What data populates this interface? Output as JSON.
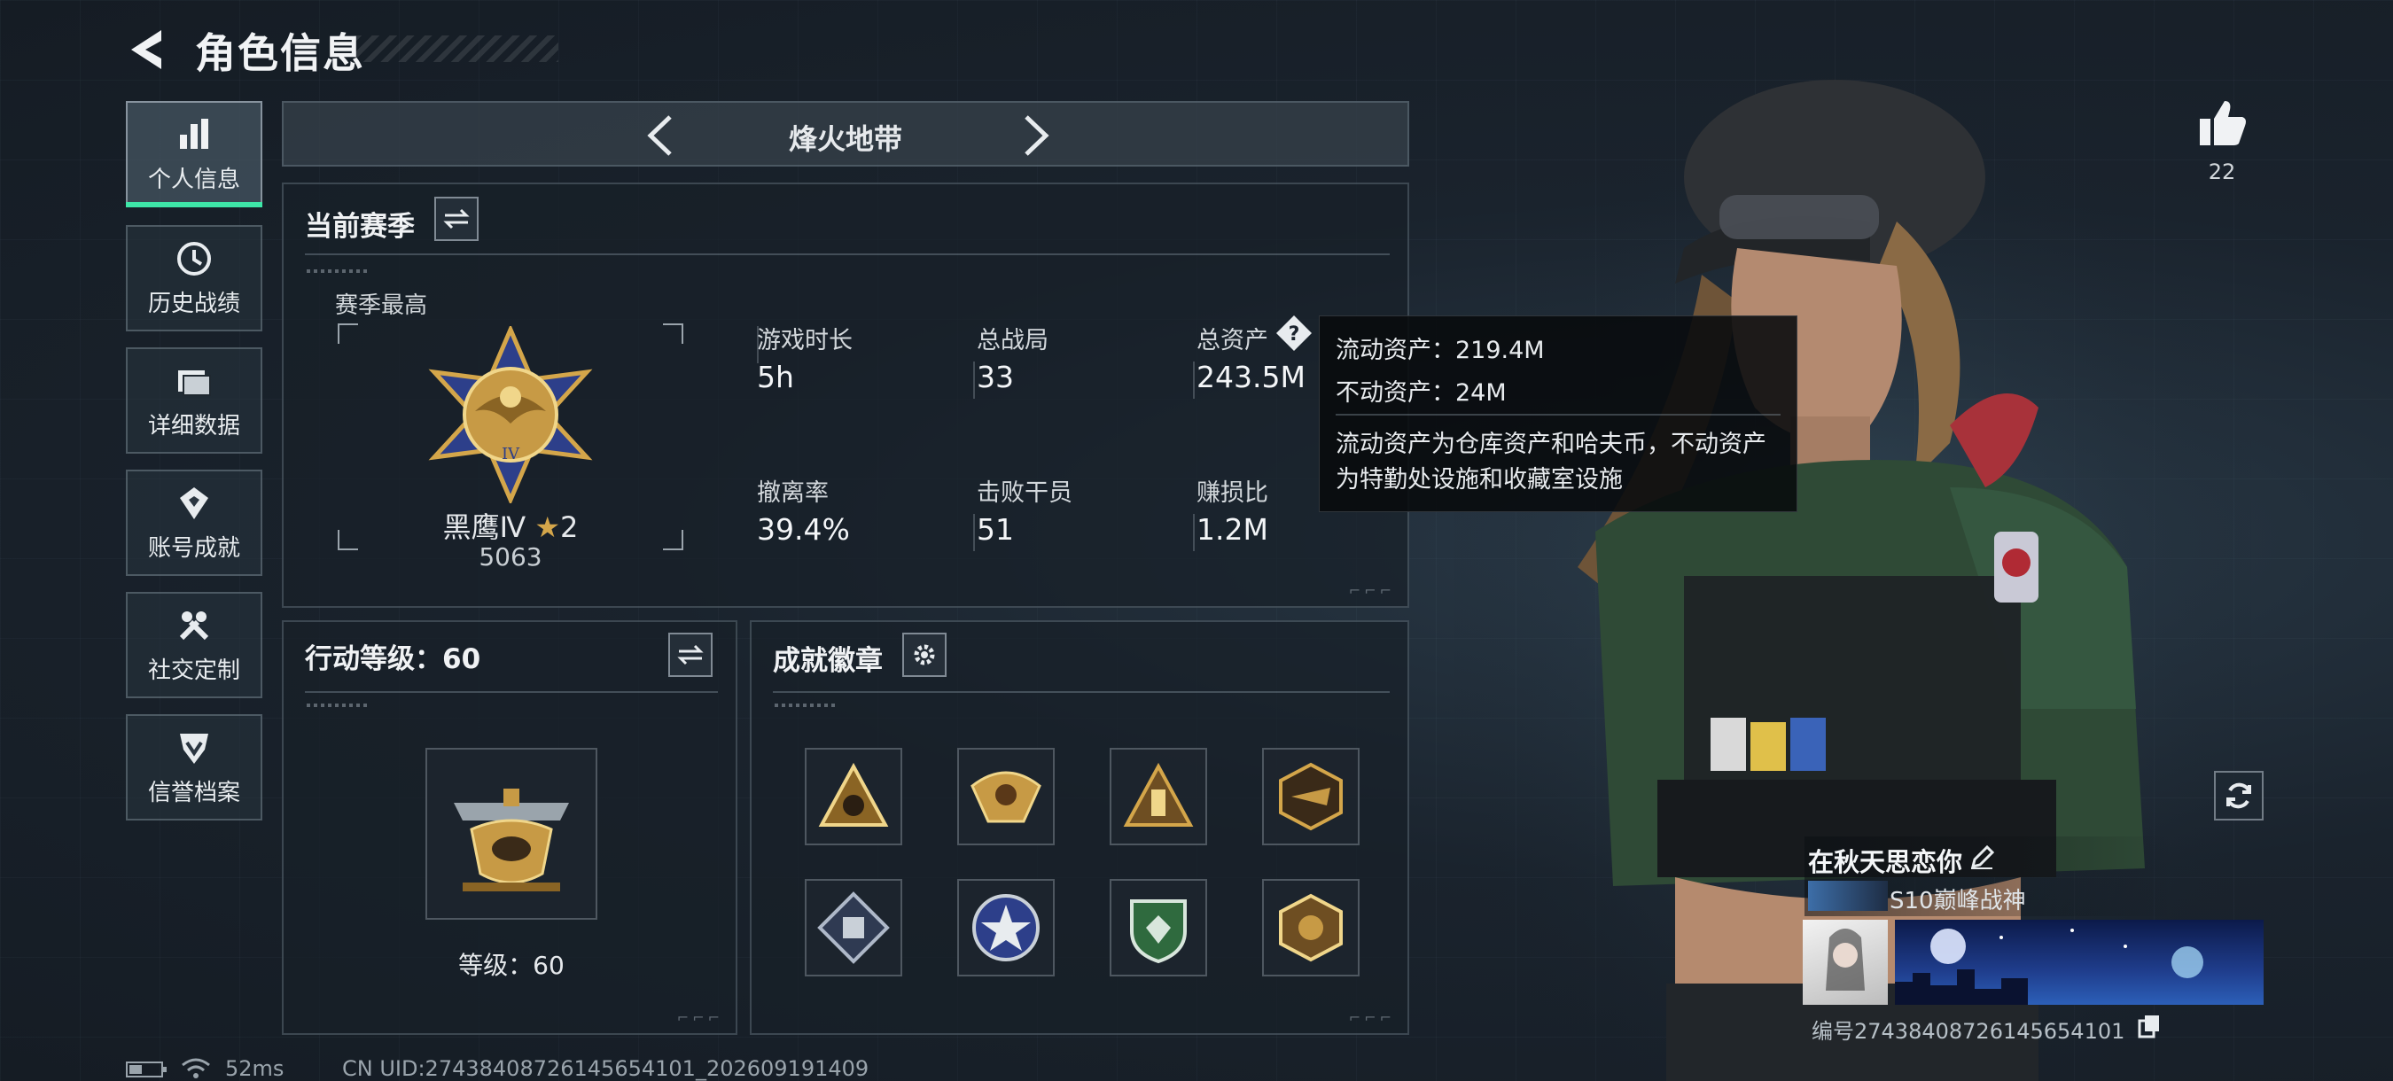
{
  "header": {
    "title": "角色信息"
  },
  "sidebar": {
    "items": [
      {
        "label": "个人信息",
        "icon": "bar-chart-icon",
        "active": true
      },
      {
        "label": "历史战绩",
        "icon": "clock-history-icon",
        "active": false
      },
      {
        "label": "详细数据",
        "icon": "folder-icon",
        "active": false
      },
      {
        "label": "账号成就",
        "icon": "medal-icon",
        "active": false
      },
      {
        "label": "社交定制",
        "icon": "wrench-icon",
        "active": false
      },
      {
        "label": "信誉档案",
        "icon": "shield-check-icon",
        "active": false
      }
    ]
  },
  "mode": {
    "title": "烽火地带"
  },
  "season": {
    "title": "当前赛季",
    "best_label": "赛季最高",
    "rank_name": "黑鹰Ⅳ",
    "rank_stars": "2",
    "rank_score": "5063",
    "stats": [
      {
        "label": "游戏时长",
        "value": "5h"
      },
      {
        "label": "总战局",
        "value": "33"
      },
      {
        "label": "总资产",
        "value": "243.5M"
      },
      {
        "label": "撤离率",
        "value": "39.4%"
      },
      {
        "label": "击败干员",
        "value": "51"
      },
      {
        "label": "赚损比",
        "value": "1.2M"
      }
    ]
  },
  "tooltip": {
    "liquid": "流动资产：219.4M",
    "fixed": "不动资产：24M",
    "desc1": "流动资产为仓库资产和哈夫币，不动资产",
    "desc2": "为特勤处设施和收藏室设施"
  },
  "level": {
    "title": "行动等级：60",
    "caption": "等级：60"
  },
  "badges": {
    "title": "成就徽章",
    "items": [
      "badge-1",
      "badge-2",
      "badge-3",
      "badge-4",
      "badge-5",
      "badge-6",
      "badge-7",
      "badge-8"
    ]
  },
  "profile": {
    "likes": "22",
    "nickname": "在秋天思恋你",
    "title": "S10巅峰战神",
    "id": "编号2743840872614565410​1"
  },
  "status": {
    "ping": "52ms",
    "uid": "CN UID:274384087261456541​01_202609191409"
  },
  "colors": {
    "accent": "#3ee6a8",
    "gold": "#d4a64a"
  }
}
